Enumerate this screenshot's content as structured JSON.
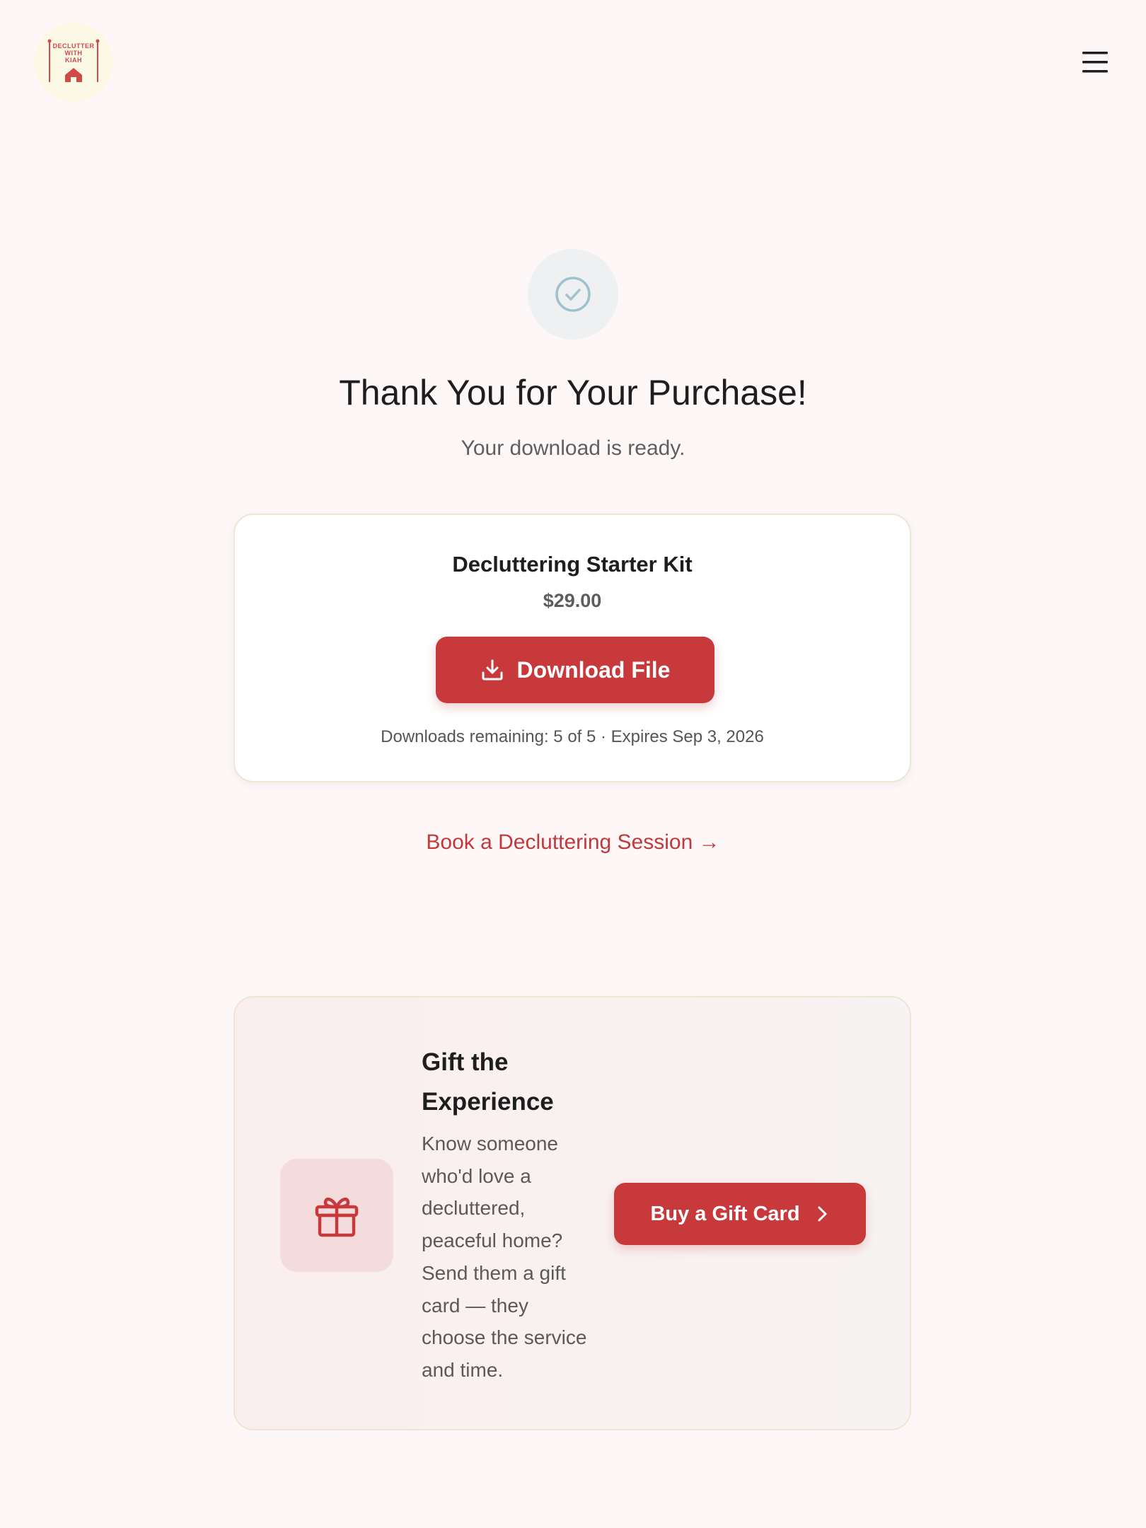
{
  "header": {
    "logo_text": [
      "DECLUTTER",
      "WITH",
      "KIAH"
    ],
    "menu_icon": "hamburger-menu-icon"
  },
  "confirmation": {
    "icon": "check-circle-icon",
    "title": "Thank You for Your Purchase!",
    "subtitle": "Your download is ready."
  },
  "product": {
    "name": "Decluttering Starter Kit",
    "price": "$29.00",
    "download_label": "Download File",
    "download_icon": "download-icon",
    "meta": "Downloads remaining: 5 of 5 · Expires Sep 3, 2026"
  },
  "links": {
    "session": "Book a Decluttering Session →"
  },
  "gift": {
    "icon": "gift-icon",
    "title": "Gift the Experience",
    "text": "Know someone who'd love a decluttered, peaceful home? Send them a gift card — they choose the service and time.",
    "button_label": "Buy a Gift Card",
    "button_icon": "chevron-right-icon"
  },
  "colors": {
    "background": "#fdf8f7",
    "accent": "#c8393c",
    "logo_bg": "#fbf9e6",
    "check_icon": "#9fc2cc"
  }
}
